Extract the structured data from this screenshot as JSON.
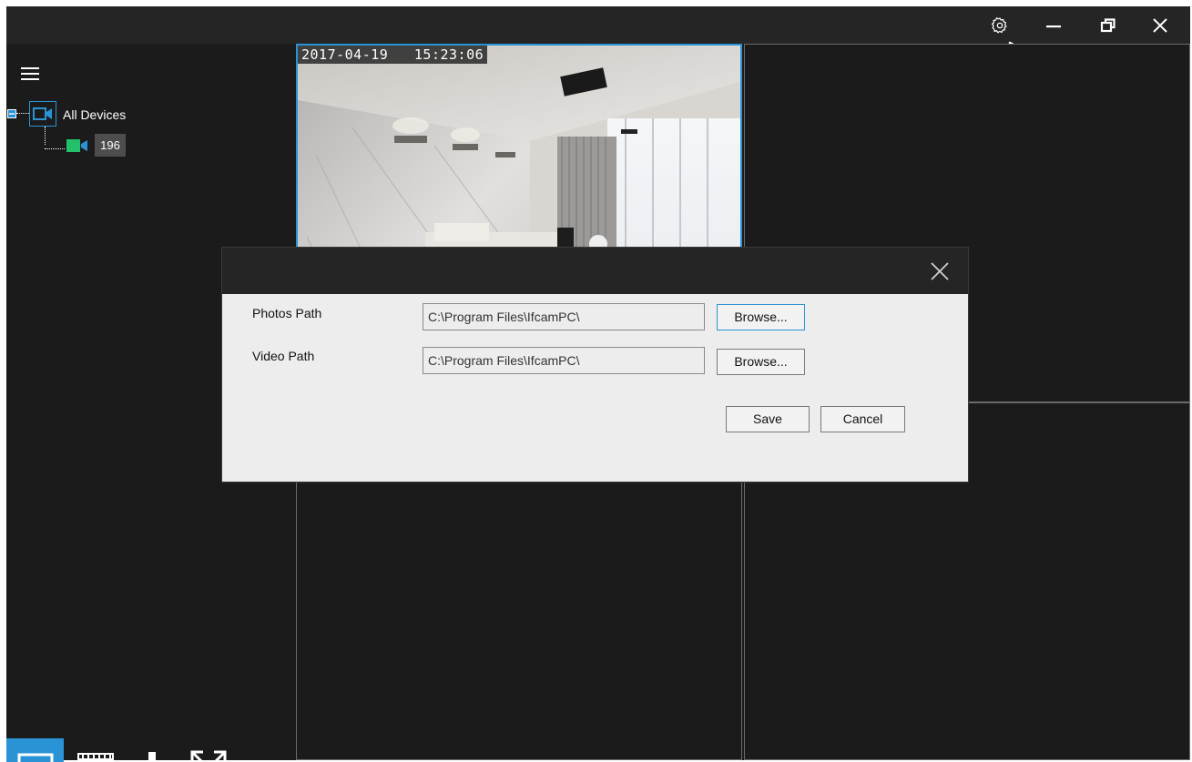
{
  "window": {
    "settings_icon": "gear-icon",
    "minimize_icon": "minimize-icon",
    "restore_icon": "restore-icon",
    "close_icon": "close-icon"
  },
  "sidebar": {
    "menu_icon": "hamburger-menu-icon",
    "tree": {
      "root_label": "All Devices",
      "children": [
        {
          "label": "196"
        }
      ]
    },
    "bottom_toolbar": [
      {
        "icon": "monitor-icon",
        "active": true
      },
      {
        "icon": "playback-film-icon",
        "active": false
      },
      {
        "icon": "plus-icon",
        "active": false
      },
      {
        "icon": "fullscreen-icon",
        "active": false
      }
    ]
  },
  "grid": {
    "camera_osd": "2017-04-19   15:23:06"
  },
  "dialog": {
    "close_icon": "close-icon",
    "photos_label": "Photos Path",
    "photos_value": "C:\\Program Files\\IfcamPC\\",
    "video_label": "Video Path",
    "video_value": "C:\\Program Files\\IfcamPC\\",
    "browse_label": "Browse...",
    "save_label": "Save",
    "cancel_label": "Cancel"
  },
  "colors": {
    "accent": "#2a93d5",
    "camera_green": "#22c06a",
    "background": "#1b1b1b",
    "titlebar": "#252525",
    "dialog_body": "#ededed"
  }
}
